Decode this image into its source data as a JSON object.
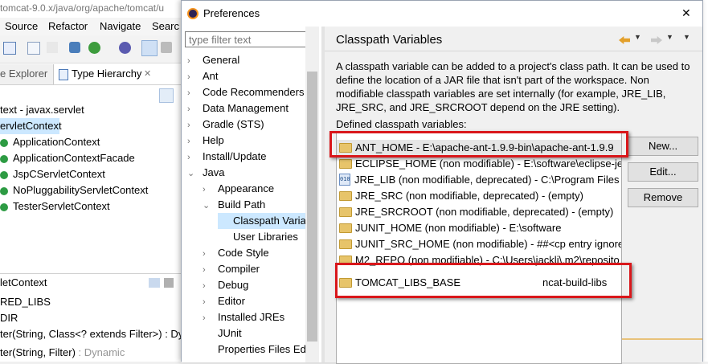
{
  "ide": {
    "title": "tomcat-9.0.x/java/org/apache/tomcat/u",
    "menu": [
      "Source",
      "Refactor",
      "Navigate",
      "Searc"
    ],
    "tabs": {
      "explorer": "e Explorer",
      "hierarchy": "Type Hierarchy",
      "close": "✕"
    },
    "hierarchy": {
      "root_context": "text - javax.servlet",
      "selected": "ervletContext",
      "items": [
        "ApplicationContext",
        "ApplicationContextFacade",
        "JspCServletContext",
        "NoPluggabilityServletContext",
        "TesterServletContext"
      ]
    },
    "members_title": "letContext",
    "members": [
      "RED_LIBS",
      "DIR",
      "ter(String, Class<? extends Filter>) : Dy",
      "ter(String, Filter)"
    ],
    "dynamic_label": ": Dynamic"
  },
  "dialog": {
    "title": "Preferences",
    "close": "✕",
    "filter_placeholder": "type filter text",
    "tree": [
      {
        "label": "General",
        "level": 0,
        "state": "collapsed"
      },
      {
        "label": "Ant",
        "level": 0,
        "state": "collapsed"
      },
      {
        "label": "Code Recommenders",
        "level": 0,
        "state": "collapsed"
      },
      {
        "label": "Data Management",
        "level": 0,
        "state": "collapsed"
      },
      {
        "label": "Gradle (STS)",
        "level": 0,
        "state": "collapsed"
      },
      {
        "label": "Help",
        "level": 0,
        "state": "collapsed"
      },
      {
        "label": "Install/Update",
        "level": 0,
        "state": "collapsed"
      },
      {
        "label": "Java",
        "level": 0,
        "state": "expanded"
      },
      {
        "label": "Appearance",
        "level": 1,
        "state": "collapsed"
      },
      {
        "label": "Build Path",
        "level": 1,
        "state": "expanded"
      },
      {
        "label": "Classpath Varia",
        "level": 2,
        "state": "leaf",
        "selected": true
      },
      {
        "label": "User Libraries",
        "level": 2,
        "state": "leaf"
      },
      {
        "label": "Code Style",
        "level": 1,
        "state": "collapsed"
      },
      {
        "label": "Compiler",
        "level": 1,
        "state": "collapsed"
      },
      {
        "label": "Debug",
        "level": 1,
        "state": "collapsed"
      },
      {
        "label": "Editor",
        "level": 1,
        "state": "collapsed"
      },
      {
        "label": "Installed JREs",
        "level": 1,
        "state": "collapsed"
      },
      {
        "label": "JUnit",
        "level": 1,
        "state": "leaf"
      },
      {
        "label": "Properties Files Ed",
        "level": 1,
        "state": "leaf"
      }
    ],
    "page": {
      "title": "Classpath Variables",
      "description": "A classpath variable can be added to a project's class path. It can be used to define the location of a JAR file that isn't part of the workspace. Non modifiable classpath variables are set internally (for example, JRE_LIB, JRE_SRC, and JRE_SRCROOT depend on the JRE setting).",
      "list_label": "Defined classpath variables:",
      "variables": [
        {
          "text": "ANT_HOME - E:\\apache-ant-1.9.9-bin\\apache-ant-1.9.9",
          "icon": "folder-icon",
          "highlighted": true
        },
        {
          "text": "ECLIPSE_HOME (non modifiable) - E:\\software\\eclipse-jee",
          "icon": "folder-icon"
        },
        {
          "text": "JRE_LIB (non modifiable, deprecated) - C:\\Program Files",
          "icon": "jar-icon"
        },
        {
          "text": "JRE_SRC (non modifiable, deprecated) - (empty)",
          "icon": "folder-icon"
        },
        {
          "text": "JRE_SRCROOT (non modifiable, deprecated) - (empty)",
          "icon": "folder-icon"
        },
        {
          "text": "JUNIT_HOME (non modifiable) - E:\\software",
          "icon": "folder-icon"
        },
        {
          "text": "JUNIT_SRC_HOME (non modifiable) - ##<cp entry ignore",
          "icon": "folder-icon"
        },
        {
          "text": "M2_REPO (non modifiable) - C:\\Users\\jackli\\.m2\\reposito",
          "icon": "folder-icon"
        },
        {
          "text": "TOMCAT_LIBS_BASE",
          "suffix": "ncat-build-libs",
          "icon": "folder-icon",
          "highlighted": true
        }
      ],
      "buttons": {
        "new": "New...",
        "edit": "Edit...",
        "remove": "Remove"
      }
    },
    "highlight_color": "#d9171b"
  }
}
